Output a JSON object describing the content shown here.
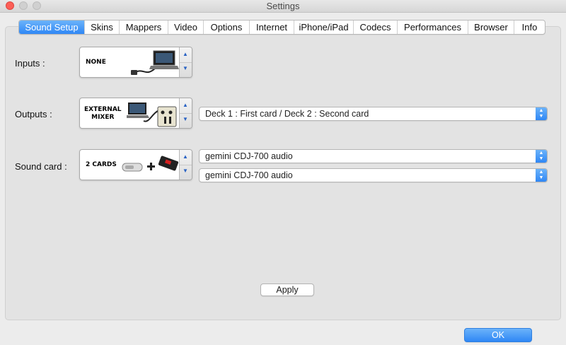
{
  "window": {
    "title": "Settings"
  },
  "tabs": [
    {
      "label": "Sound Setup",
      "active": true
    },
    {
      "label": "Skins"
    },
    {
      "label": "Mappers"
    },
    {
      "label": "Video"
    },
    {
      "label": "Options"
    },
    {
      "label": "Internet"
    },
    {
      "label": "iPhone/iPad"
    },
    {
      "label": "Codecs"
    },
    {
      "label": "Performances"
    },
    {
      "label": "Browser"
    },
    {
      "label": "Info"
    }
  ],
  "inputs": {
    "label": "Inputs :",
    "picker_text": "NONE"
  },
  "outputs": {
    "label": "Outputs :",
    "picker_text_line1": "EXTERNAL",
    "picker_text_line2": "MIXER",
    "select_value": "Deck 1 : First card / Deck 2 : Second card"
  },
  "soundcard": {
    "label": "Sound card :",
    "picker_text": "2 CARDS",
    "select1_value": "gemini CDJ-700 audio",
    "select2_value": "gemini CDJ-700 audio"
  },
  "buttons": {
    "apply": "Apply",
    "ok": "OK"
  },
  "colors": {
    "accent": "#2f87f5",
    "close_light": "#fc5f57"
  }
}
